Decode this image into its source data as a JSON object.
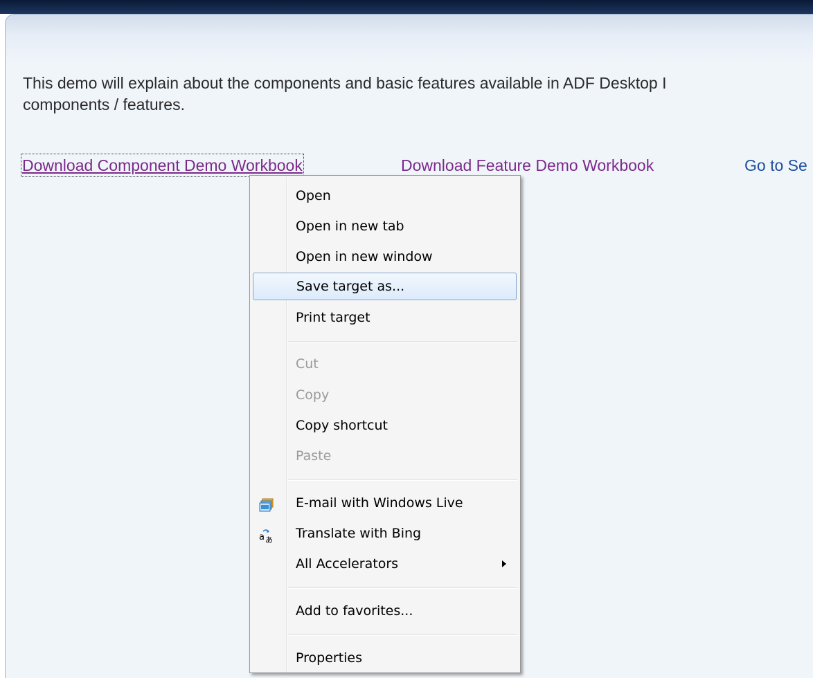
{
  "page": {
    "intro_line1": "This demo will explain about the components and basic features available in ADF Desktop I",
    "intro_line2": "components / features."
  },
  "links": {
    "component_demo": "Download Component Demo Workbook",
    "feature_demo": "Download Feature Demo Workbook",
    "go_to": "Go to Se"
  },
  "context_menu": {
    "open": "Open",
    "open_new_tab": "Open in new tab",
    "open_new_window": "Open in new window",
    "save_target_as": "Save target as...",
    "print_target": "Print target",
    "cut": "Cut",
    "copy": "Copy",
    "copy_shortcut": "Copy shortcut",
    "paste": "Paste",
    "email_windows_live": "E-mail with Windows Live",
    "translate_bing": "Translate with Bing",
    "all_accelerators": "All Accelerators",
    "add_to_favorites": "Add to favorites...",
    "properties": "Properties"
  },
  "icons": {
    "email": "windows-live-mail-icon",
    "translate": "translate-icon",
    "submenu": "submenu-arrow-icon"
  },
  "colors": {
    "visited_link": "#7b2a8a",
    "link": "#1d4f9a",
    "highlight_border": "#7da2ce",
    "disabled_text": "#9a9a9a"
  }
}
